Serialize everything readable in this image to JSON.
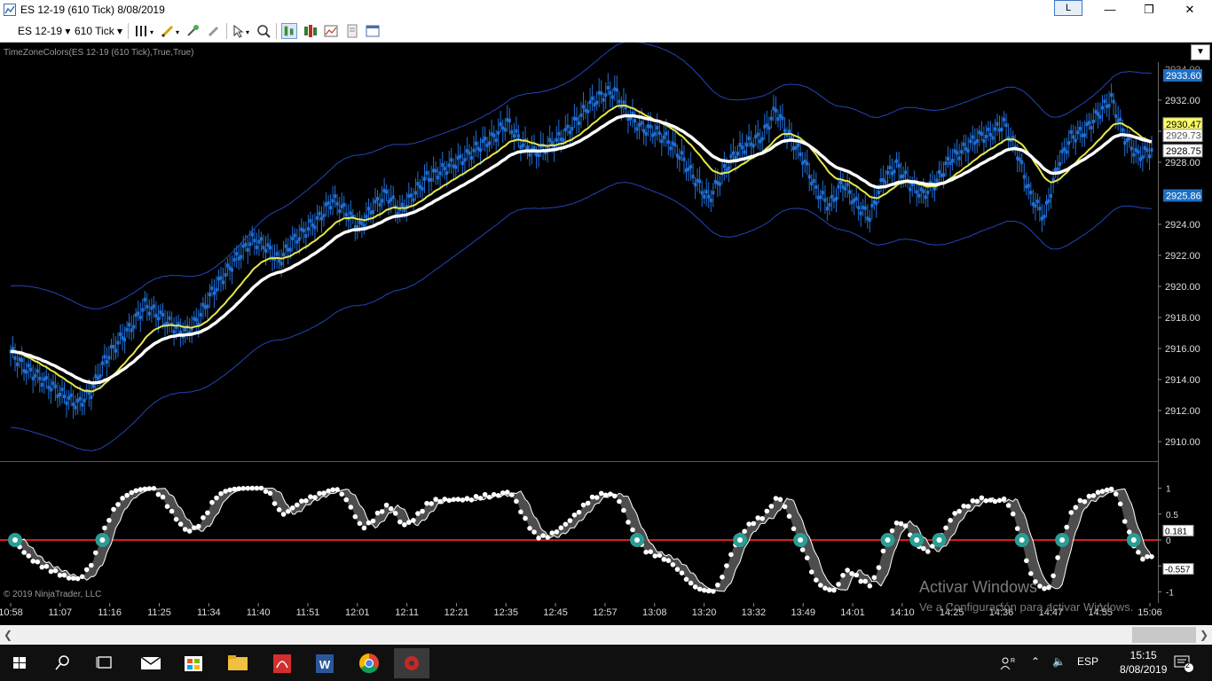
{
  "window": {
    "title": "ES 12-19 (610 Tick)  8/08/2019",
    "link_button": "L",
    "minimize_icon": "minimize-icon",
    "maximize_icon": "restore-icon",
    "close_icon": "close-icon"
  },
  "toolbar": {
    "instrument": "ES 12-19",
    "interval": "610 Tick",
    "icons": [
      "bar-style-icon",
      "drawing-tool-icon",
      "add-indicator-icon",
      "eraser-icon",
      "pointer-icon",
      "zoom-icon",
      "chart-trader-icon",
      "strategies-icon",
      "data-box-icon",
      "properties-icon",
      "templates-icon"
    ]
  },
  "chart": {
    "indicator_label": "TimeZoneColors(ES 12-19 (610 Tick),True,True)",
    "copyright": "© 2019 NinjaTrader, LLC",
    "colors": {
      "background": "#000000",
      "candles": "#1f6fd6",
      "bands": "#2146b8",
      "fast_ma": "#e6e64a",
      "slow_ma": "#ffffff",
      "zero_line": "#d21f1f",
      "cross_marker": "#2a9d95",
      "label_blue": "#1c6fc4",
      "label_yellow": "#ffff66"
    },
    "price_axis": [
      "2932.00",
      "2930.00",
      "2928.00",
      "2924.00",
      "2922.00",
      "2920.00",
      "2918.00",
      "2916.00",
      "2914.00",
      "2912.00",
      "2910.00"
    ],
    "price_labels": {
      "upper_band": "2933.60",
      "fast_ma": "2930.47",
      "slow_ma": "2929.73",
      "last_price": "2928.75",
      "lower_band": "2925.86"
    },
    "price_axis_partial": "2934.00",
    "osc_axis": [
      "1",
      "0.5",
      "0",
      "-0.5",
      "-1"
    ],
    "osc_labels": {
      "fast": "0.181",
      "slow": "-0.557"
    },
    "time_axis": [
      "10:58",
      "11:07",
      "11:16",
      "11:25",
      "11:34",
      "11:40",
      "11:51",
      "12:01",
      "12:11",
      "12:21",
      "12:35",
      "12:45",
      "12:57",
      "13:08",
      "13:20",
      "13:32",
      "13:49",
      "14:01",
      "14:10",
      "14:25",
      "14:36",
      "14:47",
      "14:55",
      "15:06"
    ],
    "price_series": [
      2915.8,
      2914.8,
      2914.2,
      2913.6,
      2912.9,
      2912.4,
      2913.2,
      2915.2,
      2916.4,
      2917.4,
      2918.8,
      2918.2,
      2917.5,
      2917.0,
      2917.9,
      2919.6,
      2920.8,
      2922.0,
      2923.0,
      2922.6,
      2921.6,
      2922.9,
      2923.6,
      2924.4,
      2925.6,
      2924.8,
      2923.8,
      2925.1,
      2926.0,
      2924.8,
      2925.9,
      2927.0,
      2927.4,
      2927.9,
      2928.4,
      2929.1,
      2929.6,
      2930.6,
      2929.3,
      2928.6,
      2929.0,
      2929.6,
      2930.5,
      2931.6,
      2932.3,
      2932.6,
      2931.1,
      2930.2,
      2930.0,
      2929.4,
      2928.3,
      2926.9,
      2925.6,
      2927.2,
      2928.6,
      2929.2,
      2929.7,
      2931.4,
      2929.7,
      2928.3,
      2926.2,
      2925.2,
      2926.7,
      2925.3,
      2924.5,
      2926.9,
      2927.8,
      2926.6,
      2925.9,
      2926.8,
      2928.2,
      2928.8,
      2929.6,
      2929.8,
      2930.5,
      2928.6,
      2925.8,
      2924.5,
      2927.8,
      2929.6,
      2930.0,
      2931.1,
      2932.1,
      2929.6,
      2928.4,
      2928.8
    ]
  },
  "watermark": {
    "line1": "Activar Windows",
    "line2": "Ve a Configuración para activar Windows."
  },
  "taskbar": {
    "apps": [
      "windows-start-icon",
      "search-icon",
      "task-view-icon",
      "mail-icon",
      "store-icon",
      "file-explorer-icon",
      "pdf-reader-icon",
      "word-icon",
      "chrome-icon",
      "ninjatrader-icon"
    ],
    "language": "ESP",
    "time": "15:15",
    "date": "8/08/2019",
    "notification_count": "2"
  }
}
